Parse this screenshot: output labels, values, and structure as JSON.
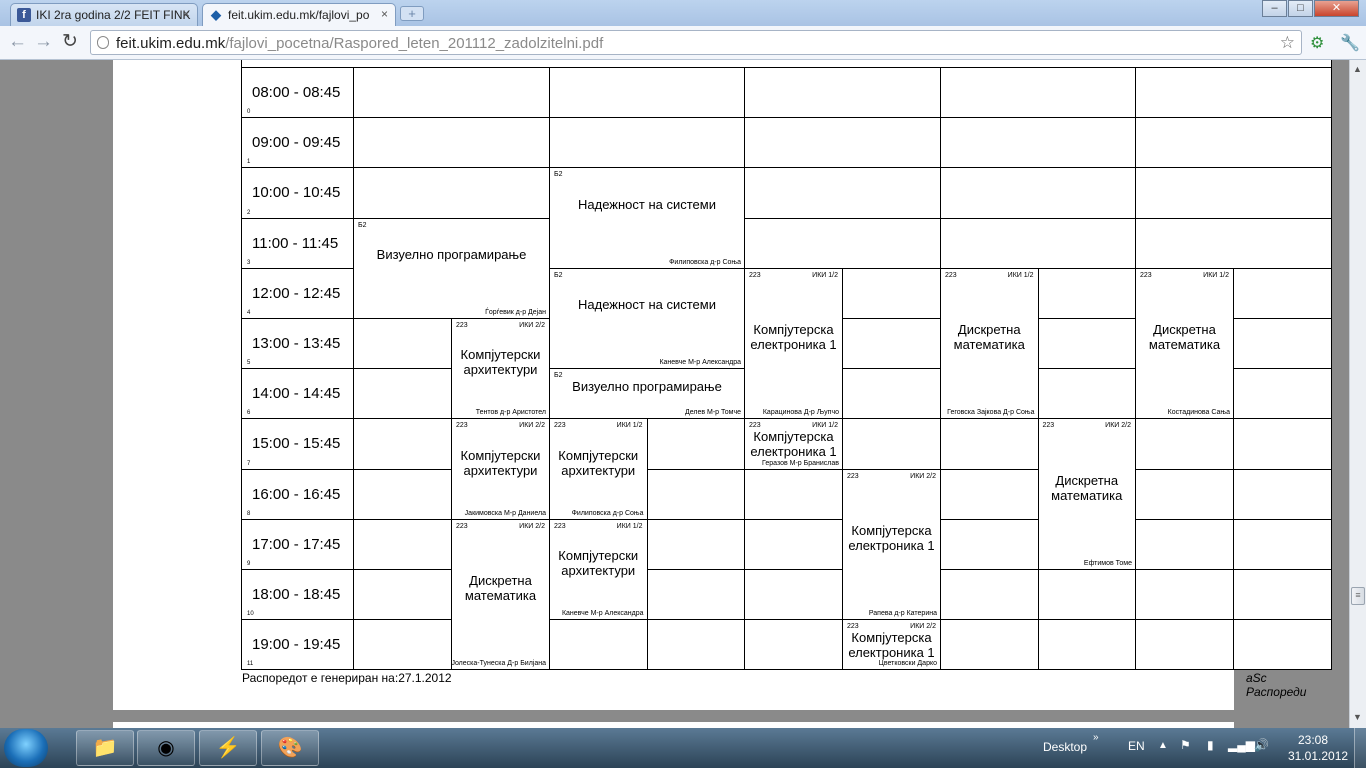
{
  "browser": {
    "tabs": [
      {
        "label": "IKI 2ra godina 2/2 FEIT FINK",
        "icon": "facebook-icon",
        "active": false
      },
      {
        "label": "feit.ukim.edu.mk/fajlovi_po",
        "icon": "feit-diamond-icon",
        "active": true
      }
    ],
    "new_tab_label": "+",
    "close_symbol": "×",
    "window_controls": {
      "minimize": "–",
      "maximize": "□",
      "close": "✕"
    },
    "url_host": "feit.ukim.edu.mk",
    "url_path": "/fajlovi_pocetna/Raspored_leten_201112_zadolzitelni.pdf"
  },
  "timetable": {
    "rows": [
      {
        "time": "08:00 - 08:45",
        "index": "0"
      },
      {
        "time": "09:00 - 09:45",
        "index": "1"
      },
      {
        "time": "10:00 - 10:45",
        "index": "2"
      },
      {
        "time": "11:00 - 11:45",
        "index": "3"
      },
      {
        "time": "12:00 - 12:45",
        "index": "4"
      },
      {
        "time": "13:00 - 13:45",
        "index": "5"
      },
      {
        "time": "14:00 - 14:45",
        "index": "6"
      },
      {
        "time": "15:00 - 15:45",
        "index": "7"
      },
      {
        "time": "16:00 - 16:45",
        "index": "8"
      },
      {
        "time": "17:00 - 17:45",
        "index": "9"
      },
      {
        "time": "18:00 - 18:45",
        "index": "10"
      },
      {
        "time": "19:00 - 19:45",
        "index": "11"
      }
    ],
    "lectures": [
      {
        "room": "Б2",
        "group": "",
        "title": "Визуелно програмирање",
        "teacher": "Ѓорѓевик д-р Дејан"
      },
      {
        "room": "Б2",
        "group": "",
        "title": "Надежност на системи",
        "teacher": "Филиповска д-р Соња"
      },
      {
        "room": "Б2",
        "group": "",
        "title": "Надежност на системи",
        "teacher": "Каневче М-р Александра"
      },
      {
        "room": "Б2",
        "group": "",
        "title": "Визуелно програмирање",
        "teacher": "Делев М-р Томче"
      },
      {
        "room": "223",
        "group": "ИКИ 2/2",
        "title": "Компјутерски архитектури",
        "teacher": "Тентов д-р Аристотел"
      },
      {
        "room": "223",
        "group": "ИКИ 2/2",
        "title": "Компјутерски архитектури",
        "teacher": "Јакимовска М-р Даниела"
      },
      {
        "room": "223",
        "group": "ИКИ 2/2",
        "title": "Дискретна математика",
        "teacher": "Јолеска-Тунеска Д-р Билјана"
      },
      {
        "room": "223",
        "group": "ИКИ 1/2",
        "title": "Компјутерски архитектури",
        "teacher": "Филиповска д-р Соња"
      },
      {
        "room": "223",
        "group": "ИКИ 1/2",
        "title": "Компјутерски архитектури",
        "teacher": "Каневче М-р Александра"
      },
      {
        "room": "223",
        "group": "ИКИ 1/2",
        "title": "Компјутерска електроника 1",
        "teacher": "Карациновa Д-р Љупчо"
      },
      {
        "room": "223",
        "group": "ИКИ 1/2",
        "title": "Компјутерска електроника 1",
        "teacher": "Геразов М-р Бранислав"
      },
      {
        "room": "223",
        "group": "ИКИ 2/2",
        "title": "Компјутерска електроника 1",
        "teacher": "Рапева д-р Катерина"
      },
      {
        "room": "223",
        "group": "ИКИ 2/2",
        "title": "Компјутерска електроника 1",
        "teacher": "Цветковски Дарко"
      },
      {
        "room": "223",
        "group": "ИКИ 1/2",
        "title": "Дискретна математика",
        "teacher": "Геговска Зајкова Д-р Соња"
      },
      {
        "room": "223",
        "group": "ИКИ 2/2",
        "title": "Дискретна математика",
        "teacher": "Ефтимов Томе"
      },
      {
        "room": "223",
        "group": "ИКИ 1/2",
        "title": "Дискретна математика",
        "teacher": "Костадинова Сања"
      }
    ],
    "footer_left": "Распоредот е генериран на:27.1.2012",
    "footer_right": "aSc Распореди"
  },
  "taskbar": {
    "desktop_label": "Desktop",
    "desktop_chevron": "»",
    "language": "EN",
    "time": "23:08",
    "date": "31.01.2012"
  }
}
